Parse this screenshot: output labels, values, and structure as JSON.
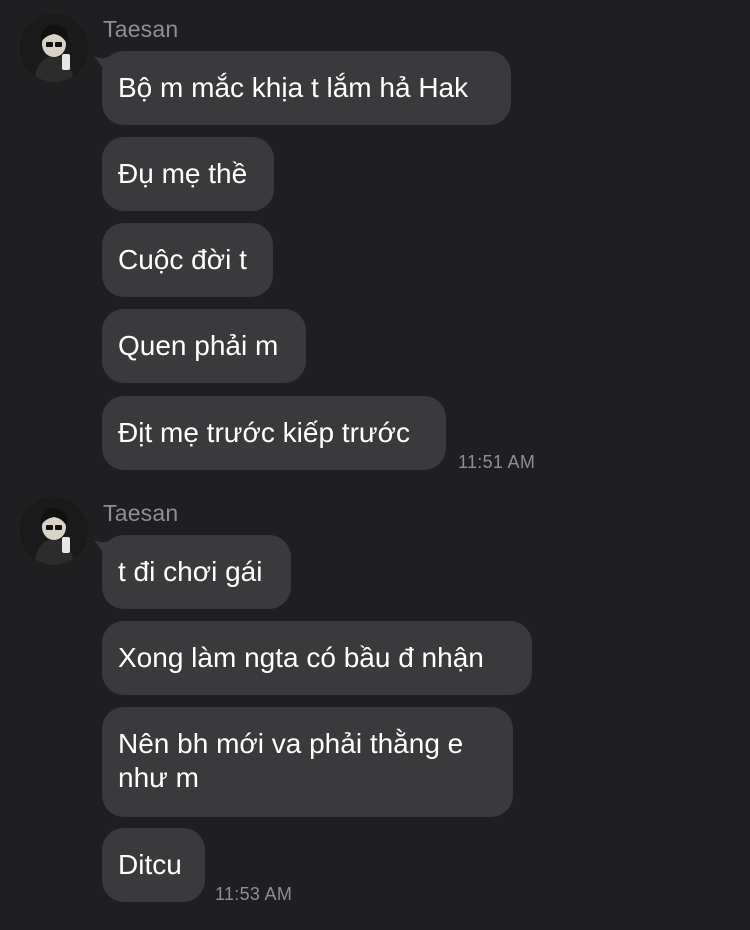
{
  "colors": {
    "background": "#1f1f21",
    "bubble": "#3a3a3c",
    "secondary_text": "#8e8e93",
    "text": "#ffffff"
  },
  "groups": [
    {
      "sender": "Taesan",
      "avatar_icon": "profile-photo",
      "messages": [
        "Bộ m mắc khịa t lắm hả Hak",
        "Đụ mẹ thề",
        "Cuộc đời t",
        "Quen phải m",
        "Địt mẹ trước kiếp trước"
      ],
      "time": "11:51 AM"
    },
    {
      "sender": "Taesan",
      "avatar_icon": "profile-photo",
      "messages": [
        "t đi chơi gái",
        "Xong làm ngta có bầu đ nhận",
        "Nên bh mới va phải thằng e như m",
        "Ditcu"
      ],
      "time": "11:53 AM"
    }
  ]
}
